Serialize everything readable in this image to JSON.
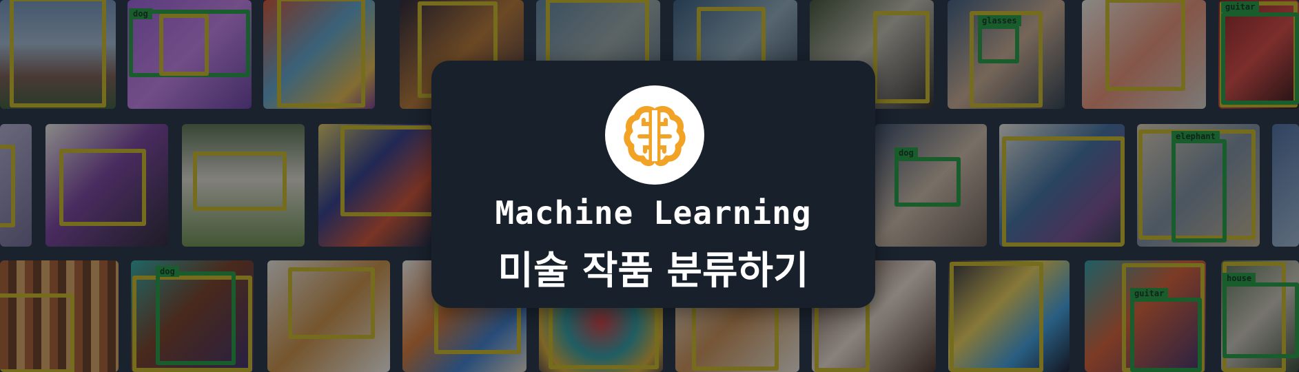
{
  "banner": {
    "title_en": "Machine Learning",
    "title_ko": "미술 작품 분류하기",
    "logo_icon": "brain-icon",
    "accent_color": "#f2a325"
  },
  "detections": {
    "dog_1": "dog",
    "glasses": "glasses",
    "guitar_1": "guitar",
    "dog_2": "dog",
    "elephant": "elephant",
    "dog_3": "dog",
    "guitar_2": "guitar",
    "house": "house"
  }
}
